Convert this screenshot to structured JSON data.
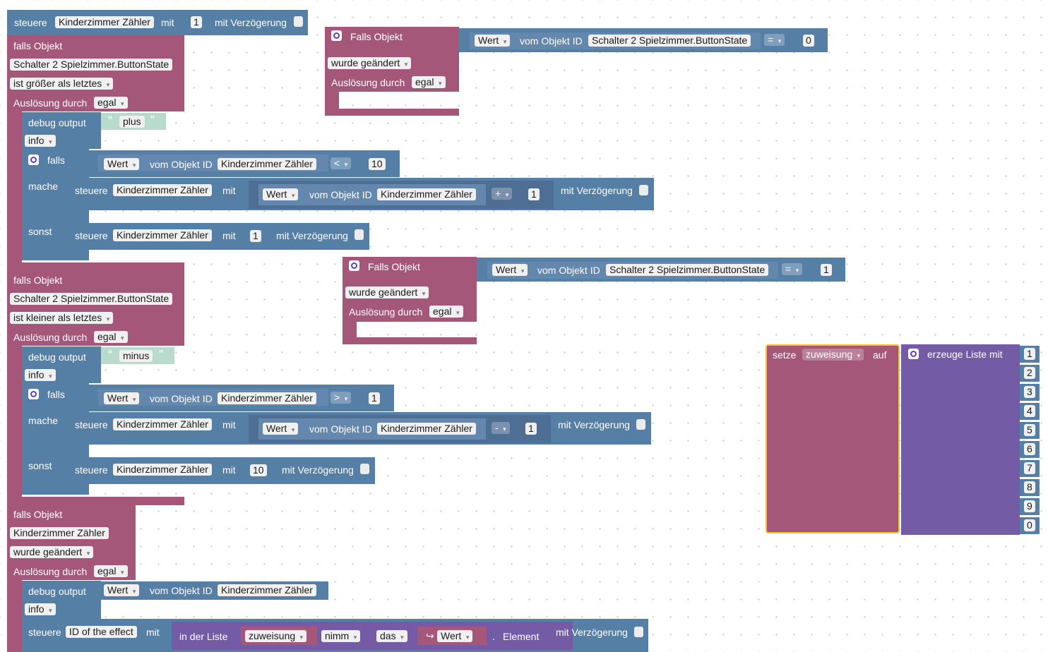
{
  "lbl": {
    "steuere": "steuere",
    "mit": "mit",
    "mit_verzoegerung": "mit Verzögerung",
    "falls_objekt_lower": "falls Objekt",
    "falls_objekt_cap": "Falls Objekt",
    "ausloesung": "Auslösung durch",
    "debug": "debug output",
    "falls": "falls",
    "mache": "mache",
    "sonst": "sonst",
    "wert": "Wert",
    "vom_objekt_id": "vom Objekt ID",
    "setze": "setze",
    "auf": "auf",
    "erzeuge_liste": "erzeuge Liste mit",
    "in_der_liste": "in der Liste",
    "element": "Element"
  },
  "opts": {
    "egal": "egal",
    "info": "info",
    "wurde_geaendert": "wurde geändert",
    "ist_groesser": "ist größer als letztes",
    "ist_kleiner": "ist kleiner als letztes",
    "nimm": "nimm",
    "das": "das"
  },
  "ids": {
    "zaehler": "Kinderzimmer Zähler",
    "button": "Schalter 2 Spielzimmer.ButtonState",
    "effect": "ID of the effect",
    "var": "zuweisung"
  },
  "ops": {
    "lt": "<",
    "gt": ">",
    "eq": "=",
    "plus": "+",
    "minus": "-"
  },
  "nums": {
    "n0": "0",
    "n1": "1",
    "n10": "10"
  },
  "strings": {
    "plus": "plus",
    "minus": "minus"
  },
  "list_items": [
    "1",
    "2",
    "3",
    "4",
    "5",
    "6",
    "7",
    "8",
    "9",
    "0"
  ],
  "colors": {
    "event": "#a5577a",
    "control": "#5b80a5",
    "list": "#745ba5",
    "selected_outline": "#fbc02d"
  }
}
